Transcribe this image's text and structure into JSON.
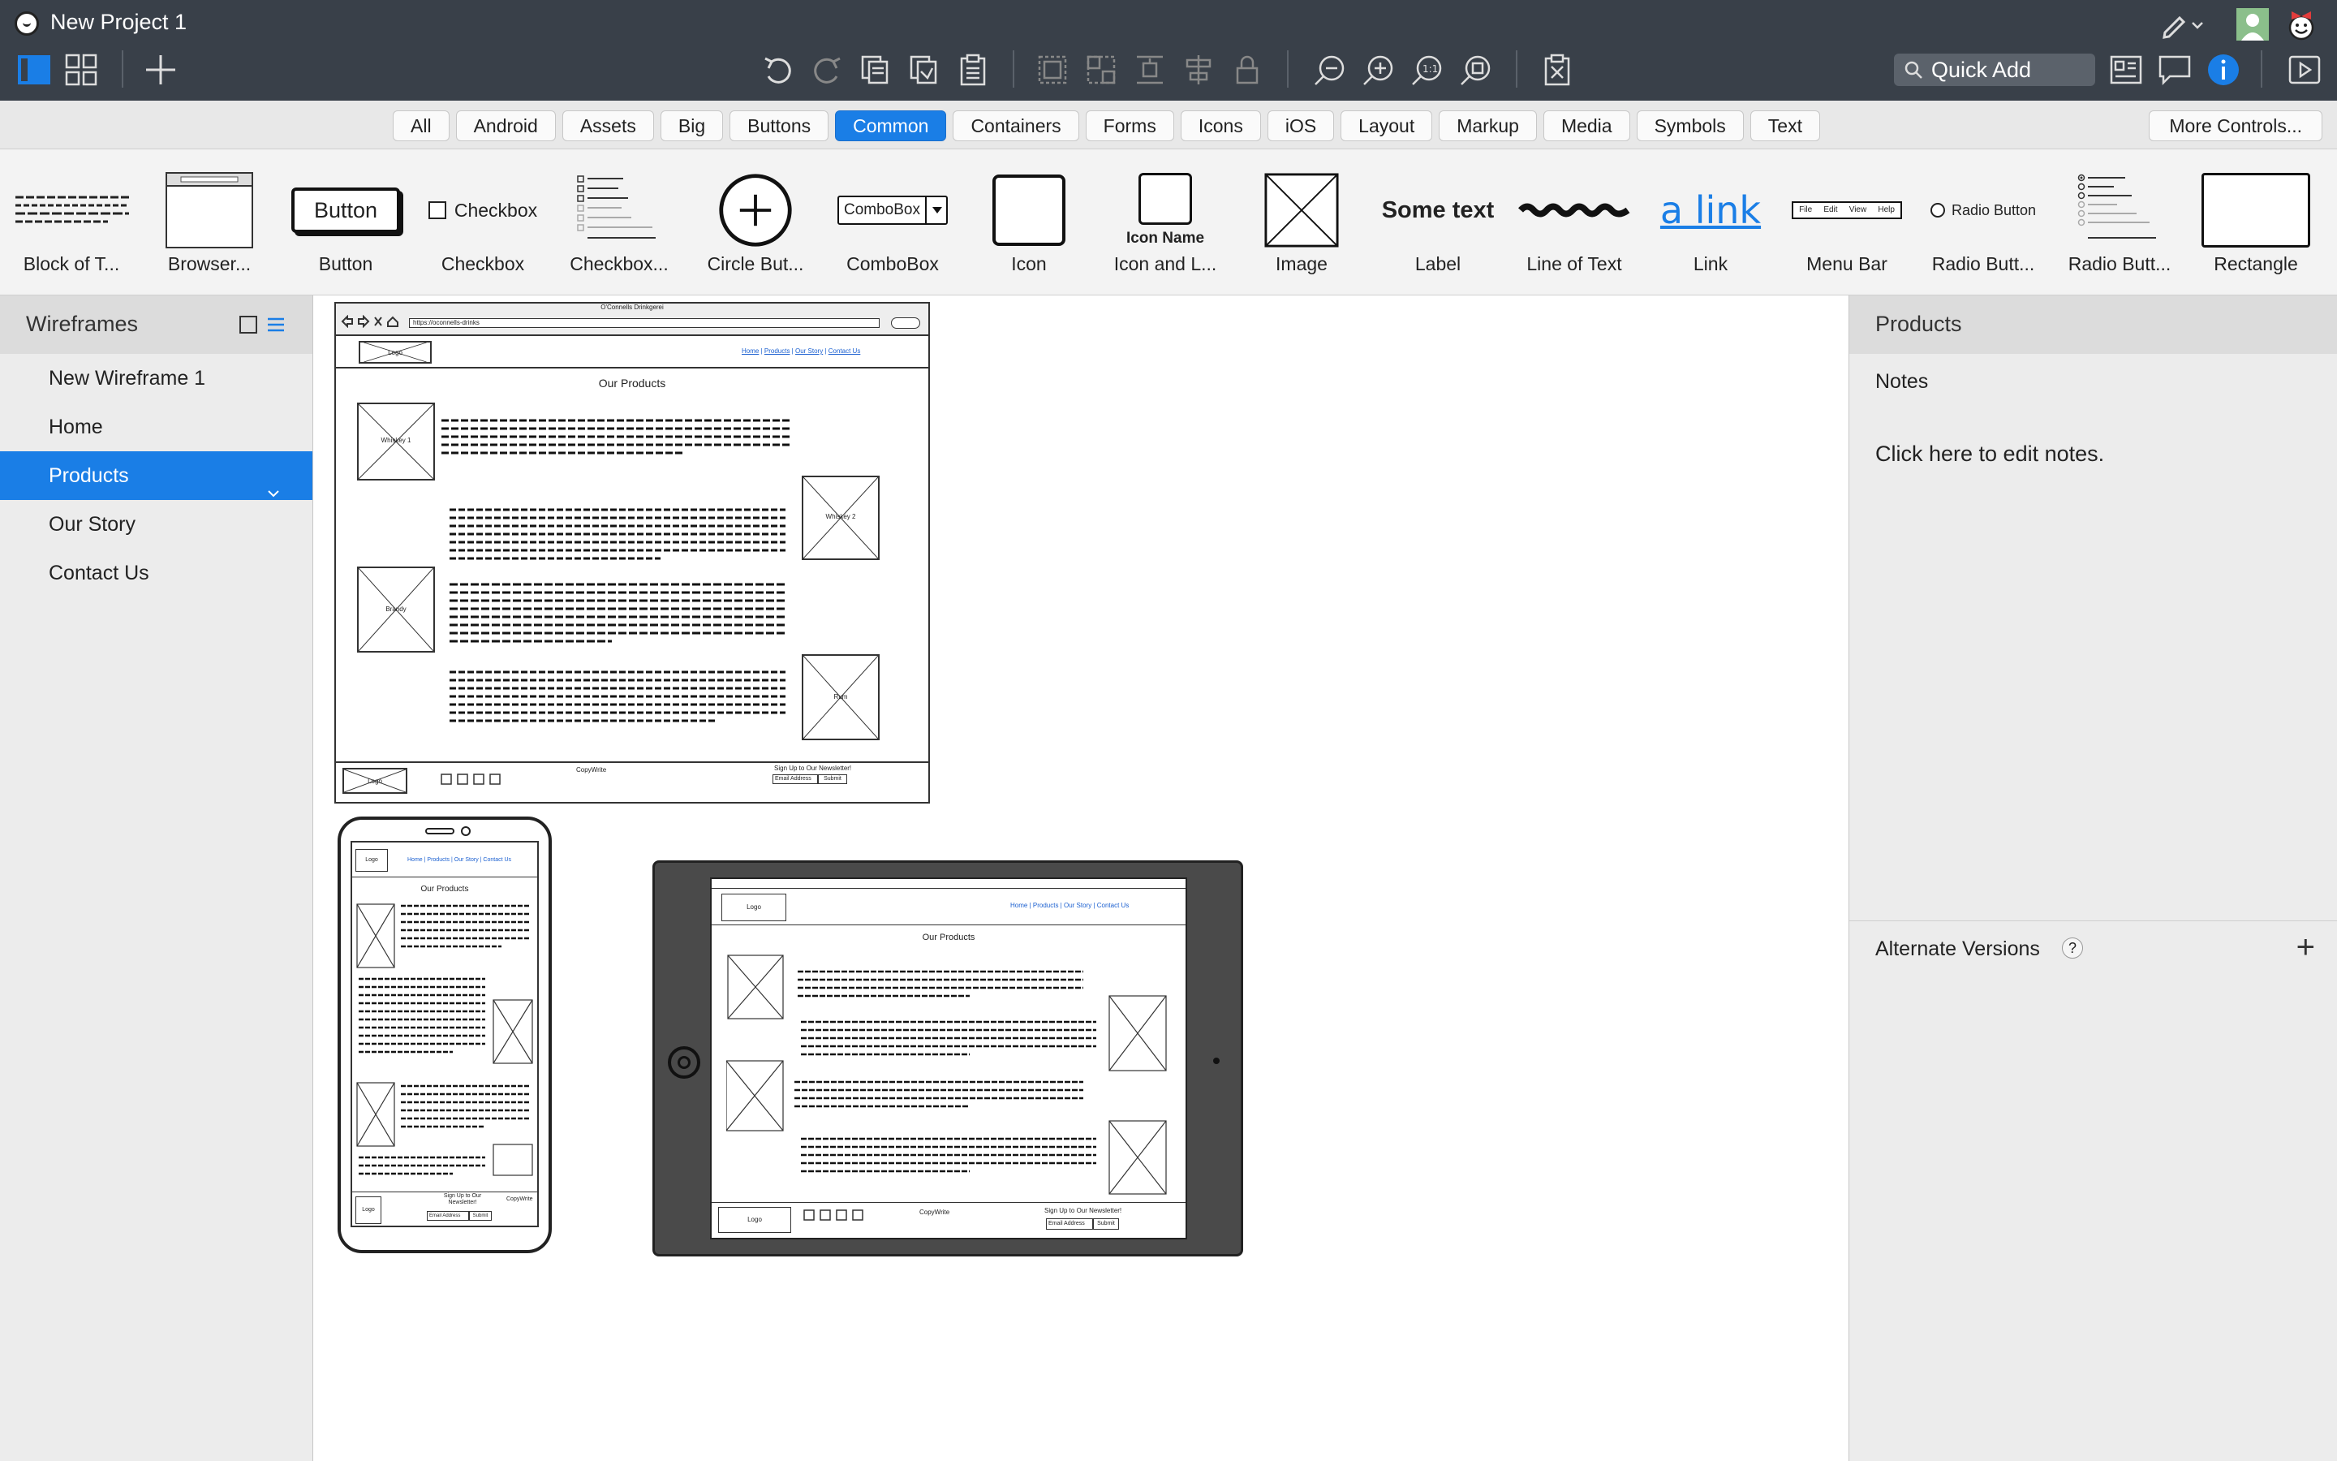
{
  "window": {
    "title": "New Project 1"
  },
  "toolbar": {
    "quick_add_placeholder": "Quick Add",
    "left_icons": [
      "single-view-icon",
      "grid-view-icon",
      "add-icon"
    ],
    "center_icons": [
      "undo-icon",
      "redo-icon",
      "duplicate-icon",
      "copy-icon",
      "paste-icon",
      "group-icon",
      "ungroup-icon",
      "distribute-icon",
      "align-icon",
      "lock-icon",
      "zoom-out-icon",
      "zoom-in-icon",
      "actual-size-icon",
      "fit-icon",
      "delete-icon"
    ],
    "right_icons": [
      "mockup-view-icon",
      "comments-icon",
      "info-icon",
      "play-icon"
    ]
  },
  "tabs": {
    "items": [
      "All",
      "Android",
      "Assets",
      "Big",
      "Buttons",
      "Common",
      "Containers",
      "Forms",
      "Icons",
      "iOS",
      "Layout",
      "Markup",
      "Media",
      "Symbols",
      "Text"
    ],
    "active": "Common",
    "more": "More Controls..."
  },
  "components": [
    {
      "label": "Block of T...",
      "icon": "block-of-text"
    },
    {
      "label": "Browser...",
      "icon": "browser-window"
    },
    {
      "label": "Button",
      "icon": "button",
      "preview_text": "Button"
    },
    {
      "label": "Checkbox",
      "icon": "checkbox",
      "preview_text": "Checkbox"
    },
    {
      "label": "Checkbox...",
      "icon": "checkbox-group"
    },
    {
      "label": "Circle But...",
      "icon": "circle-button"
    },
    {
      "label": "ComboBox",
      "icon": "combobox",
      "preview_text": "ComboBox"
    },
    {
      "label": "Icon",
      "icon": "icon"
    },
    {
      "label": "Icon and L...",
      "icon": "icon-and-label",
      "preview_text": "Icon Name"
    },
    {
      "label": "Image",
      "icon": "image"
    },
    {
      "label": "Label",
      "icon": "label",
      "preview_text": "Some text"
    },
    {
      "label": "Line of Text",
      "icon": "line-of-text"
    },
    {
      "label": "Link",
      "icon": "link",
      "preview_text": "a link"
    },
    {
      "label": "Menu Bar",
      "icon": "menu-bar",
      "preview_items": [
        "File",
        "Edit",
        "View",
        "Help"
      ]
    },
    {
      "label": "Radio Butt...",
      "icon": "radio-button",
      "preview_text": "Radio Button"
    },
    {
      "label": "Radio Butt...",
      "icon": "radio-group"
    },
    {
      "label": "Rectangle",
      "icon": "rectangle"
    }
  ],
  "left_panel": {
    "title": "Wireframes",
    "items": [
      "New Wireframe 1",
      "Home",
      "Products",
      "Our Story",
      "Contact Us"
    ],
    "selected": "Products"
  },
  "right_panel": {
    "title": "Products",
    "notes_label": "Notes",
    "notes_placeholder": "Click here to edit notes.",
    "alternate_versions": "Alternate Versions",
    "help": "?",
    "add": "+"
  },
  "wireframe": {
    "heading": "Our Products",
    "logo": "Logo",
    "nav": [
      "Home",
      "Products",
      "Our Story",
      "Contact Us"
    ],
    "images": [
      "Whiskey 1",
      "Whiskey 2",
      "Brandy",
      "Rum"
    ],
    "footer": {
      "copyright": "CopyWrite",
      "newsletter": "Sign Up to Our Newsletter!",
      "email": "Email Address",
      "submit": "Submit"
    },
    "browser_title": "O'Connells Drinkgerei",
    "browser_url": "https://oconnells-drinks"
  }
}
